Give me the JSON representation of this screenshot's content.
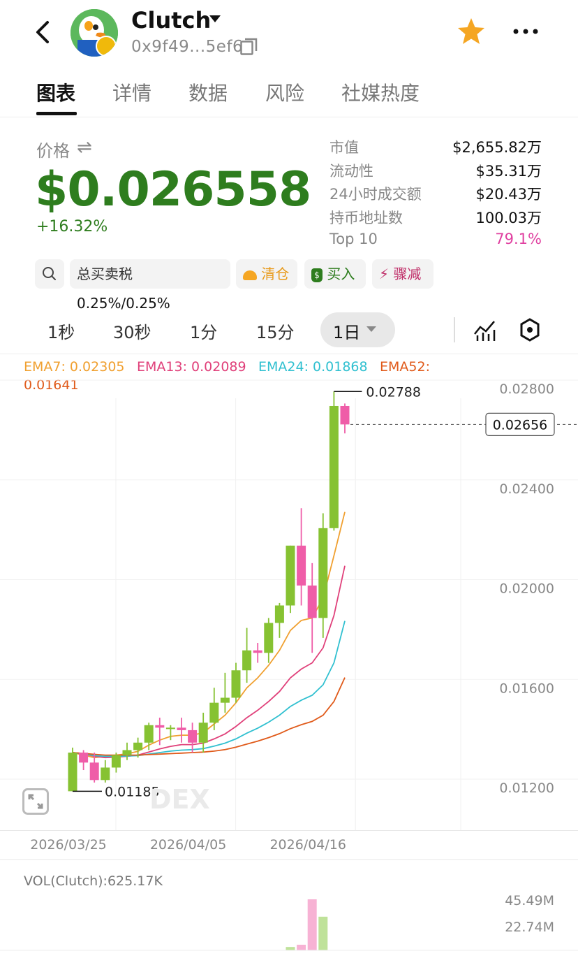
{
  "header": {
    "token_name": "Clutch",
    "address": "0x9f49...5ef6"
  },
  "tabs": [
    {
      "label": "图表"
    },
    {
      "label": "详情"
    },
    {
      "label": "数据"
    },
    {
      "label": "风险"
    },
    {
      "label": "社媒热度"
    }
  ],
  "price": {
    "label": "价格",
    "value": "$0.026558",
    "change": "+16.32%"
  },
  "stats": [
    {
      "label": "市值",
      "value": "$2,655.82万"
    },
    {
      "label": "流动性",
      "value": "$35.31万"
    },
    {
      "label": "24小时成交额",
      "value": "$20.43万"
    },
    {
      "label": "持币地址数",
      "value": "100.03万"
    },
    {
      "label": "Top 10",
      "value": "79.1%"
    }
  ],
  "actions": {
    "tax_label": "总买卖税",
    "tax_value": "0.25%/0.25%",
    "clear": "清仓",
    "buy": "买入",
    "dump": "骤减"
  },
  "timeframes": [
    "1秒",
    "30秒",
    "1分",
    "15分",
    "1日"
  ],
  "colors": {
    "up": "#86c232",
    "down": "#ef5da8",
    "price_green": "#2e7d1e",
    "ema7": "#f0a030",
    "ema13": "#e0407a",
    "ema24": "#30c0d0",
    "ema52": "#e05a1a",
    "star": "#f5a623"
  },
  "chart_data": {
    "type": "candlestick",
    "ema": [
      {
        "name": "EMA7",
        "label": "EMA7: 0.02305"
      },
      {
        "name": "EMA13",
        "label": "EMA13: 0.02089"
      },
      {
        "name": "EMA24",
        "label": "EMA24: 0.01868"
      },
      {
        "name": "EMA52",
        "label": "EMA52:",
        "value_label": "0.01641"
      }
    ],
    "y_ticks": [
      "0.02800",
      "0.02400",
      "0.02000",
      "0.01600",
      "0.01200"
    ],
    "y_tick_values": [
      0.028,
      0.024,
      0.02,
      0.016,
      0.012
    ],
    "x_ticks": [
      "2026/03/25",
      "2026/04/05",
      "2026/04/16"
    ],
    "x_tick_index": [
      0,
      11,
      22
    ],
    "high_label": "0.02788",
    "low_label": "0.01185",
    "current_label": "0.02656",
    "high": 0.02788,
    "low": 0.01185,
    "current": 0.02656,
    "candles": [
      {
        "o": 0.01185,
        "h": 0.0136,
        "l": 0.01185,
        "c": 0.0134
      },
      {
        "o": 0.0134,
        "h": 0.0135,
        "l": 0.0127,
        "c": 0.013
      },
      {
        "o": 0.013,
        "h": 0.0134,
        "l": 0.0122,
        "c": 0.0123
      },
      {
        "o": 0.0123,
        "h": 0.0131,
        "l": 0.0122,
        "c": 0.0128
      },
      {
        "o": 0.0128,
        "h": 0.0134,
        "l": 0.0126,
        "c": 0.0133
      },
      {
        "o": 0.0133,
        "h": 0.0138,
        "l": 0.0131,
        "c": 0.0135
      },
      {
        "o": 0.0135,
        "h": 0.014,
        "l": 0.0132,
        "c": 0.0138
      },
      {
        "o": 0.0138,
        "h": 0.0146,
        "l": 0.0135,
        "c": 0.0145
      },
      {
        "o": 0.0145,
        "h": 0.0148,
        "l": 0.0137,
        "c": 0.0144
      },
      {
        "o": 0.0144,
        "h": 0.0145,
        "l": 0.0139,
        "c": 0.0144
      },
      {
        "o": 0.0144,
        "h": 0.0148,
        "l": 0.0138,
        "c": 0.0143
      },
      {
        "o": 0.0143,
        "h": 0.0146,
        "l": 0.0134,
        "c": 0.0138
      },
      {
        "o": 0.0138,
        "h": 0.015,
        "l": 0.0134,
        "c": 0.0146
      },
      {
        "o": 0.0146,
        "h": 0.016,
        "l": 0.0143,
        "c": 0.0154
      },
      {
        "o": 0.0154,
        "h": 0.0166,
        "l": 0.015,
        "c": 0.0156
      },
      {
        "o": 0.0156,
        "h": 0.017,
        "l": 0.0154,
        "c": 0.0167
      },
      {
        "o": 0.0167,
        "h": 0.0184,
        "l": 0.0162,
        "c": 0.0175
      },
      {
        "o": 0.0175,
        "h": 0.0178,
        "l": 0.017,
        "c": 0.0174
      },
      {
        "o": 0.0174,
        "h": 0.0188,
        "l": 0.017,
        "c": 0.0186
      },
      {
        "o": 0.0186,
        "h": 0.0194,
        "l": 0.018,
        "c": 0.0193
      },
      {
        "o": 0.0193,
        "h": 0.0212,
        "l": 0.019,
        "c": 0.0217
      },
      {
        "o": 0.0217,
        "h": 0.0232,
        "l": 0.0193,
        "c": 0.0201
      },
      {
        "o": 0.0201,
        "h": 0.021,
        "l": 0.0174,
        "c": 0.0188
      },
      {
        "o": 0.0188,
        "h": 0.023,
        "l": 0.018,
        "c": 0.0224
      },
      {
        "o": 0.0224,
        "h": 0.02788,
        "l": 0.0223,
        "c": 0.0273
      },
      {
        "o": 0.0273,
        "h": 0.0274,
        "l": 0.0262,
        "c": 0.02656
      }
    ],
    "ema_series": {
      "EMA7": [
        0.0134,
        0.0133,
        0.0132,
        0.01325,
        0.0133,
        0.01335,
        0.01345,
        0.0137,
        0.0139,
        0.01405,
        0.0141,
        0.0141,
        0.0142,
        0.01455,
        0.0149,
        0.0154,
        0.016,
        0.0164,
        0.0169,
        0.0175,
        0.0183,
        0.0187,
        0.0188,
        0.0196,
        0.0213,
        0.02305
      ],
      "EMA13": [
        0.0134,
        0.01335,
        0.01325,
        0.0132,
        0.01322,
        0.01325,
        0.0133,
        0.01342,
        0.01355,
        0.01365,
        0.01372,
        0.01372,
        0.01378,
        0.01395,
        0.01415,
        0.01445,
        0.0148,
        0.0151,
        0.01545,
        0.01585,
        0.0164,
        0.01675,
        0.017,
        0.0176,
        0.0189,
        0.02089
      ],
      "EMA24": [
        0.0134,
        0.01335,
        0.01328,
        0.01325,
        0.01325,
        0.01326,
        0.01328,
        0.01334,
        0.0134,
        0.01346,
        0.0135,
        0.01352,
        0.01356,
        0.01366,
        0.01378,
        0.01395,
        0.01418,
        0.01438,
        0.01462,
        0.0149,
        0.01525,
        0.0155,
        0.0157,
        0.01612,
        0.017,
        0.01868
      ],
      "EMA52": [
        0.0134,
        0.01337,
        0.01333,
        0.0133,
        0.0133,
        0.0133,
        0.0133,
        0.01332,
        0.01334,
        0.01336,
        0.01338,
        0.0134,
        0.01342,
        0.01346,
        0.01352,
        0.01362,
        0.01374,
        0.01386,
        0.014,
        0.01416,
        0.01436,
        0.01452,
        0.01465,
        0.0149,
        0.01545,
        0.01641
      ]
    }
  },
  "volume": {
    "label": "VOL(Clutch):625.17K",
    "y_ticks": [
      "45.49M",
      "22.74M"
    ],
    "bars": [
      {
        "index": 20,
        "value": 3.0,
        "dir": "up"
      },
      {
        "index": 21,
        "value": 5.0,
        "dir": "down"
      },
      {
        "index": 22,
        "value": 45.49,
        "dir": "down"
      },
      {
        "index": 23,
        "value": 30.0,
        "dir": "up"
      }
    ]
  },
  "watermark": "DEX"
}
